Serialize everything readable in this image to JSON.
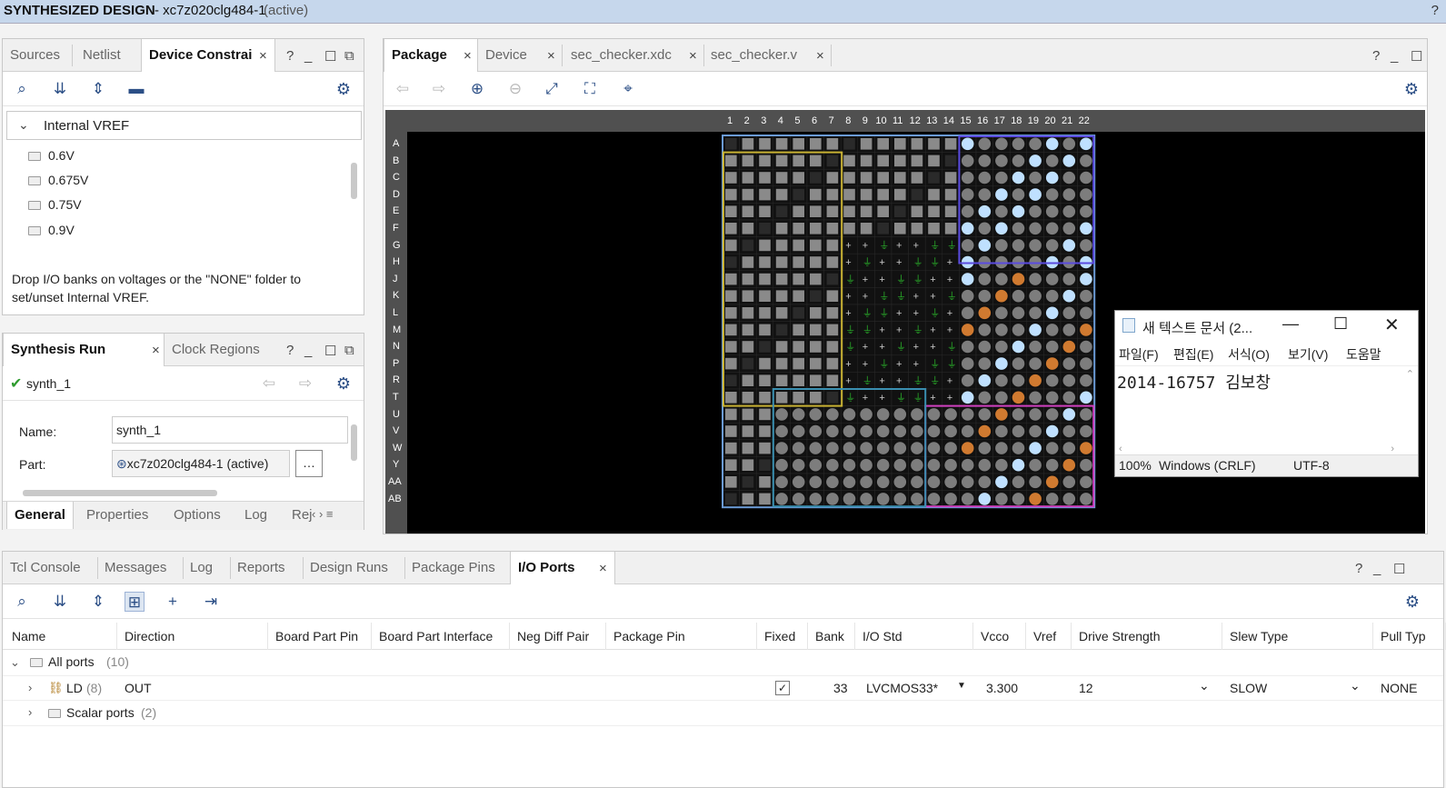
{
  "title": {
    "design": "SYNTHESIZED DESIGN",
    "part": "- xc7z020clg484-1",
    "state": "(active)",
    "help": "?"
  },
  "left_top": {
    "tabs": [
      "Sources",
      "Netlist",
      "Device Constrai"
    ],
    "close": "×",
    "ctl_help": "?",
    "header": "Internal VREF",
    "items": [
      "0.6V",
      "0.675V",
      "0.75V",
      "0.9V"
    ],
    "note": "Drop I/O banks on voltages or the \"NONE\" folder to set/unset Internal VREF."
  },
  "left_bottom": {
    "tabs": [
      "Synthesis Run Propert",
      "Clock Regions"
    ],
    "run": "synth_1",
    "name_label": "Name:",
    "name_value": "synth_1",
    "part_label": "Part:",
    "part_value": "xc7z020clg484-1 (active)",
    "dots": "…",
    "bottom_tabs": [
      "General",
      "Properties",
      "Options",
      "Log",
      "Rej"
    ]
  },
  "center": {
    "tabs": [
      "Package",
      "Device",
      "sec_checker.xdc",
      "sec_checker.v"
    ],
    "cols": [
      "1",
      "2",
      "3",
      "4",
      "5",
      "6",
      "7",
      "8",
      "9",
      "10",
      "11",
      "12",
      "13",
      "14",
      "15",
      "16",
      "17",
      "18",
      "19",
      "20",
      "21",
      "22"
    ],
    "rows": [
      "A",
      "B",
      "C",
      "D",
      "E",
      "F",
      "G",
      "H",
      "J",
      "K",
      "L",
      "M",
      "N",
      "P",
      "R",
      "T",
      "U",
      "V",
      "W",
      "Y",
      "AA",
      "AB"
    ]
  },
  "notepad": {
    "title": "새 텍스트 문서 (2...",
    "menu": [
      "파일(F)",
      "편집(E)",
      "서식(O)",
      "보기(V)",
      "도움말"
    ],
    "content": "2014-16757 김보창",
    "zoom": "100%",
    "eol": "Windows (CRLF)",
    "enc": "UTF-8"
  },
  "bottom": {
    "tabs": [
      "Tcl Console",
      "Messages",
      "Log",
      "Reports",
      "Design Runs",
      "Package Pins",
      "I/O Ports"
    ],
    "columns": [
      "Name",
      "Direction",
      "Board Part Pin",
      "Board Part Interface",
      "Neg Diff Pair",
      "Package Pin",
      "Fixed",
      "Bank",
      "I/O Std",
      "Vcco",
      "Vref",
      "Drive Strength",
      "Slew Type",
      "Pull Typ"
    ],
    "all_ports": "All ports",
    "all_count": "(10)",
    "row_ld": {
      "name": "LD",
      "count": "(8)",
      "direction": "OUT",
      "bank": "33",
      "iostd": "LVCMOS33*",
      "vcco": "3.300",
      "drive": "12",
      "slew": "SLOW",
      "pull": "NONE",
      "fixed": true
    },
    "scalar": "Scalar ports",
    "scalar_count": "(2)"
  }
}
